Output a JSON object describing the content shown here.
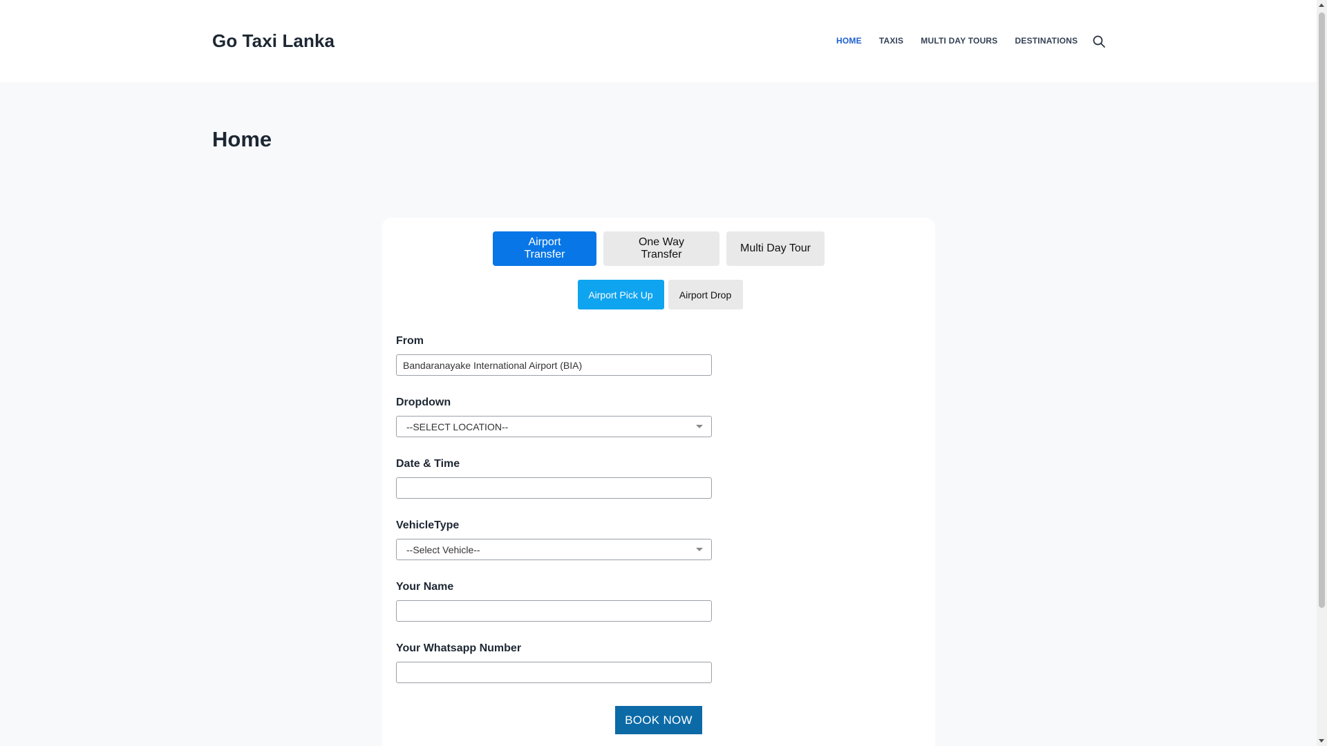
{
  "header": {
    "brand": "Go Taxi Lanka",
    "nav": [
      {
        "label": "HOME",
        "active": true
      },
      {
        "label": "TAXIS",
        "active": false
      },
      {
        "label": "MULTI DAY TOURS",
        "active": false
      },
      {
        "label": "DESTINATIONS",
        "active": false
      }
    ]
  },
  "page": {
    "title": "Home"
  },
  "booking": {
    "tabs": [
      {
        "label": "Airport Transfer",
        "active": true
      },
      {
        "label": "One Way Transfer",
        "active": false
      },
      {
        "label": "Multi Day Tour",
        "active": false
      }
    ],
    "subtabs": [
      {
        "label": "Airport Pick Up",
        "active": true
      },
      {
        "label": "Airport Drop",
        "active": false
      }
    ],
    "fields": {
      "from": {
        "label": "From",
        "value": "Bandaranayake International Airport (BIA)"
      },
      "dropdown": {
        "label": "Dropdown",
        "selected": "--SELECT LOCATION--"
      },
      "datetime": {
        "label": "Date & Time",
        "value": ""
      },
      "vehicle": {
        "label": "VehicleType",
        "selected": "--Select Vehicle--"
      },
      "name": {
        "label": "Your Name",
        "value": ""
      },
      "whatsapp": {
        "label": "Your Whatsapp Number",
        "value": ""
      }
    },
    "submit_label": "BOOK NOW"
  },
  "colors": {
    "accent": "#0876e6",
    "subtab_accent": "#0fa4f0",
    "submit": "#0c6aa7",
    "nav_active": "#1c5fd0"
  }
}
